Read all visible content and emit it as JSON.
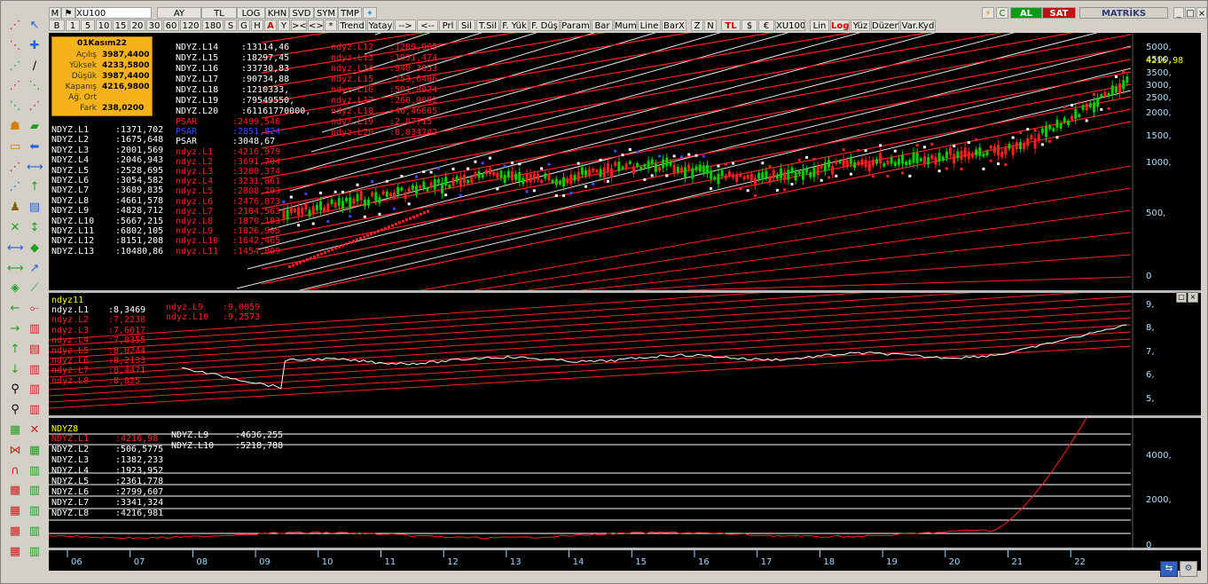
{
  "symbol": "XU100",
  "toolbar": {
    "row1": [
      "AY",
      "TL",
      "LOG",
      "KHN",
      "SVD",
      "SYM",
      "TMP"
    ],
    "row2": [
      "B",
      "1",
      "5",
      "10",
      "15",
      "20",
      "30",
      "60",
      "120",
      "180",
      "S",
      "G",
      "H",
      "A",
      "Y",
      "><",
      "<>",
      "*",
      "Trend",
      "Yatay",
      "-->",
      "<--",
      "Prl",
      "Sil",
      "T.Sil",
      "F. Yük",
      "F. Düş",
      "Param",
      "Bar",
      "Mum",
      "Line",
      "BarX",
      "Z",
      "N",
      "TL",
      "$",
      "€",
      "XU100",
      "Lin",
      "Log",
      "Yüz",
      "Düzen",
      "Var.Kyd"
    ],
    "buy": "AL",
    "sell": "SAT",
    "brand": "MATRİKS"
  },
  "ohlc": {
    "date": "01Kasım22",
    "rows": [
      {
        "k": "Açılış",
        "v": "3987,4400"
      },
      {
        "k": "Yüksek",
        "v": "4233,5800"
      },
      {
        "k": "Düşük",
        "v": "3987,4400"
      },
      {
        "k": "Kapanış",
        "v": "4216,9800"
      },
      {
        "k": "Ağ. Ort",
        "v": ""
      },
      {
        "k": "Fark",
        "v": "238,0200"
      }
    ]
  },
  "pane1": {
    "col_a": [
      {
        "k": "NDYZ.L14",
        "v": ":13114,46",
        "c": "wh"
      },
      {
        "k": "NDYZ.L15",
        "v": ":18297,45",
        "c": "wh"
      },
      {
        "k": "NDYZ.L16",
        "v": ":33730,83",
        "c": "wh"
      },
      {
        "k": "NDYZ.L17",
        "v": ":90734,88",
        "c": "wh"
      },
      {
        "k": "NDYZ.L18",
        "v": ":1210333,",
        "c": "wh"
      },
      {
        "k": "NDYZ.L19",
        "v": ":79549550,",
        "c": "wh"
      },
      {
        "k": "NDYZ.L20",
        "v": ":61161770000,",
        "c": "wh"
      }
    ],
    "col_b": [
      {
        "k": "ndyz.L12",
        "v": ":1289,965",
        "c": "rd"
      },
      {
        "k": "ndyz.L13",
        "v": ":1091,474",
        "c": "rd"
      },
      {
        "k": "ndyz.L14",
        "v": ":940,3853",
        "c": "rd"
      },
      {
        "k": "ndyz.L15",
        "v": ":753,6486",
        "c": "rd"
      },
      {
        "k": "ndyz.L16",
        "v": ":501,8924",
        "c": "rd"
      },
      {
        "k": "ndyz.L17",
        "v": ":260,0002",
        "c": "rd"
      },
      {
        "k": "ndyz.L18",
        "v": ":46,46665",
        "c": "rd"
      },
      {
        "k": "ndyz.L19",
        "v": ":2,87715",
        "c": "rd"
      },
      {
        "k": "ndyz.L20",
        "v": ":0,034742",
        "c": "rd"
      }
    ],
    "col_c": [
      {
        "k": "NDYZ.L1",
        "v": ":1371,702",
        "c": "wh"
      },
      {
        "k": "NDYZ.L2",
        "v": ":1675,648",
        "c": "wh"
      },
      {
        "k": "NDYZ.L3",
        "v": ":2001,569",
        "c": "wh"
      },
      {
        "k": "NDYZ.L4",
        "v": ":2046,943",
        "c": "wh"
      },
      {
        "k": "NDYZ.L5",
        "v": ":2528,695",
        "c": "wh"
      },
      {
        "k": "NDYZ.L6",
        "v": ":3054,582",
        "c": "wh"
      },
      {
        "k": "NDYZ.L7",
        "v": ":3689,835",
        "c": "wh"
      },
      {
        "k": "NDYZ.L8",
        "v": ":4661,578",
        "c": "wh"
      },
      {
        "k": "NDYZ.L9",
        "v": ":4828,712",
        "c": "wh"
      },
      {
        "k": "NDYZ.L10",
        "v": ":5667,215",
        "c": "wh"
      },
      {
        "k": "NDYZ.L11",
        "v": ":6802,105",
        "c": "wh"
      },
      {
        "k": "NDYZ.L12",
        "v": ":8151,208",
        "c": "wh"
      },
      {
        "k": "NDYZ.L13",
        "v": ":10480,86",
        "c": "wh"
      }
    ],
    "col_d": [
      {
        "k": "PSAR",
        "v": ":2499,546",
        "c": "rd"
      },
      {
        "k": "PSAR",
        "v": ":2851,824",
        "c": "bl"
      },
      {
        "k": "PSAR",
        "v": ":3048,67",
        "c": "wh"
      },
      {
        "k": "ndyz.L1",
        "v": ":4216,979",
        "c": "rd"
      },
      {
        "k": "ndyz.L2",
        "v": ":3691,704",
        "c": "rd"
      },
      {
        "k": "ndyz.L3",
        "v": ":3280,374",
        "c": "rd"
      },
      {
        "k": "ndyz.L4",
        "v": ":3231,861",
        "c": "rd"
      },
      {
        "k": "ndyz.L5",
        "v": ":2808,293",
        "c": "rd"
      },
      {
        "k": "ndyz.L6",
        "v": ":2476,873",
        "c": "rd"
      },
      {
        "k": "ndyz.L7",
        "v": ":2184,563",
        "c": "rd"
      },
      {
        "k": "ndyz.L8",
        "v": ":1870,183",
        "c": "rd"
      },
      {
        "k": "ndyz.L9",
        "v": ":1826,905",
        "c": "rd"
      },
      {
        "k": "ndyz.L10",
        "v": ":1642,465",
        "c": "rd"
      },
      {
        "k": "ndyz.L11",
        "v": ":1454,809",
        "c": "rd"
      }
    ],
    "y_ticks": [
      "5000,",
      "4500,",
      "3500,",
      "3000,",
      "2500,",
      "2000,",
      "1500,",
      "1000,",
      "500,",
      "0"
    ],
    "last_price": "4216,98"
  },
  "pane2": {
    "title": "ndyz11",
    "col_a": [
      {
        "k": "ndyz.L1",
        "v": ":8,3469",
        "c": "wh"
      },
      {
        "k": "ndyz.L2",
        "v": ":7,2238",
        "c": "rd"
      },
      {
        "k": "ndyz.L3",
        "v": ":7,6017",
        "c": "rd"
      },
      {
        "k": "ndyz.L4",
        "v": ":7,8355",
        "c": "rd"
      },
      {
        "k": "ndyz.L5",
        "v": ":8,0244",
        "c": "rd"
      },
      {
        "k": "ndyz.L6",
        "v": ":8,2133",
        "c": "rd"
      },
      {
        "k": "ndyz.L7",
        "v": ":8,4471",
        "c": "rd"
      },
      {
        "k": "ndyz.L8",
        "v": ":8,825",
        "c": "rd"
      }
    ],
    "col_b": [
      {
        "k": "ndyz.L9",
        "v": ":9,0059",
        "c": "rd"
      },
      {
        "k": "ndyz.L10",
        "v": ":9,2573",
        "c": "rd"
      }
    ],
    "y_ticks": [
      "9,",
      "8,",
      "7,",
      "6,",
      "5,"
    ]
  },
  "pane3": {
    "title": "NDYZ8",
    "col_a": [
      {
        "k": "NDYZ.L1",
        "v": ":4216,98",
        "c": "rd"
      },
      {
        "k": "NDYZ.L2",
        "v": ":506,5775",
        "c": "wh"
      },
      {
        "k": "NDYZ.L3",
        "v": ":1382,233",
        "c": "wh"
      },
      {
        "k": "NDYZ.L4",
        "v": ":1923,952",
        "c": "wh"
      },
      {
        "k": "NDYZ.L5",
        "v": ":2361,778",
        "c": "wh"
      },
      {
        "k": "NDYZ.L6",
        "v": ":2799,607",
        "c": "wh"
      },
      {
        "k": "NDYZ.L7",
        "v": ":3341,324",
        "c": "wh"
      },
      {
        "k": "NDYZ.L8",
        "v": ":4216,981",
        "c": "wh"
      }
    ],
    "col_b": [
      {
        "k": "NDYZ.L9",
        "v": ":4636,255",
        "c": "wh"
      },
      {
        "k": "NDYZ.L10",
        "v": ":5218,788",
        "c": "wh"
      }
    ],
    "y_ticks": [
      "4000,",
      "2000,",
      "0"
    ]
  },
  "x_axis": [
    "06",
    "07",
    "08",
    "09",
    "10",
    "11",
    "12",
    "13",
    "14",
    "15",
    "16",
    "17",
    "18",
    "19",
    "20",
    "21",
    "22"
  ],
  "colors": {
    "background": "#000000",
    "channel": "#ff2020",
    "band": "#ffffff",
    "bull": "#00cc00",
    "bear": "#ff2020",
    "psar_red": "#ff2020",
    "psar_blue": "#3050ff",
    "psar_white": "#ffffff"
  }
}
